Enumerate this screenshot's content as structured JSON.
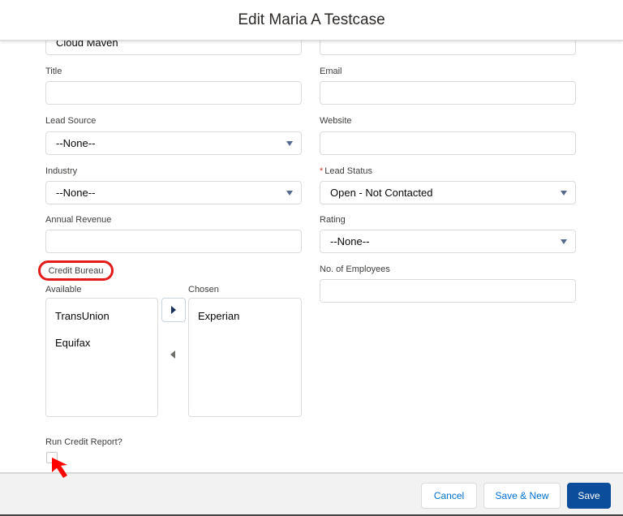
{
  "header": {
    "title": "Edit Maria A Testcase"
  },
  "form": {
    "company_value": "Cloud Maven",
    "title": {
      "label": "Title",
      "value": ""
    },
    "email": {
      "label": "Email",
      "value": ""
    },
    "lead_source": {
      "label": "Lead Source",
      "value": "--None--"
    },
    "website": {
      "label": "Website",
      "value": ""
    },
    "industry": {
      "label": "Industry",
      "value": "--None--"
    },
    "lead_status": {
      "label": "Lead Status",
      "required_marker": "*",
      "value": "Open - Not Contacted"
    },
    "annual_revenue": {
      "label": "Annual Revenue",
      "value": ""
    },
    "rating": {
      "label": "Rating",
      "value": "--None--"
    },
    "no_of_employees": {
      "label": "No. of Employees",
      "value": ""
    },
    "credit_bureau": {
      "label": "Credit Bureau",
      "available_label": "Available",
      "chosen_label": "Chosen",
      "available": [
        "TransUnion",
        "Equifax"
      ],
      "chosen": [
        "Experian"
      ]
    },
    "run_credit_report": {
      "label": "Run Credit Report?",
      "checked": false
    }
  },
  "footer": {
    "cancel_label": "Cancel",
    "save_new_label": "Save & New",
    "save_label": "Save"
  },
  "annotation": {
    "highlight_color": "#e31b1b",
    "cursor_color": "#ff0000"
  }
}
